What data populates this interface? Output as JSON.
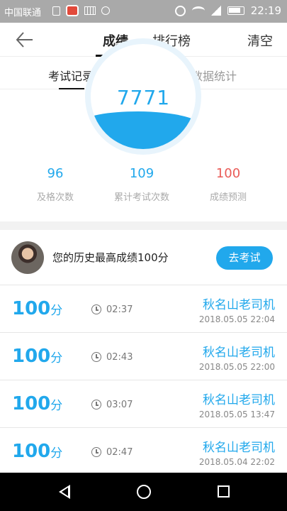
{
  "status_bar": {
    "carrier": "中国联通",
    "time": "22:19"
  },
  "header": {
    "tabs": [
      {
        "label": "成绩",
        "active": true
      },
      {
        "label": "排行榜",
        "active": false
      }
    ],
    "clear_label": "清空"
  },
  "sub_tabs": [
    {
      "label": "考试记录",
      "active": true
    },
    {
      "label": "数据统计",
      "active": false
    }
  ],
  "gauge": {
    "value": "7771"
  },
  "stats": [
    {
      "value": "96",
      "label": "及格次数"
    },
    {
      "value": "109",
      "label": "累计考试次数"
    },
    {
      "value": "100",
      "label": "成绩预测"
    }
  ],
  "best": {
    "text": "您的历史最高成绩100分",
    "button_label": "去考试"
  },
  "records": [
    {
      "score": "100",
      "unit": "分",
      "duration": "02:37",
      "name": "秋名山老司机",
      "datetime": "2018.05.05  22:04"
    },
    {
      "score": "100",
      "unit": "分",
      "duration": "02:43",
      "name": "秋名山老司机",
      "datetime": "2018.05.05  22:00"
    },
    {
      "score": "100",
      "unit": "分",
      "duration": "03:07",
      "name": "秋名山老司机",
      "datetime": "2018.05.05  13:47"
    },
    {
      "score": "100",
      "unit": "分",
      "duration": "02:47",
      "name": "秋名山老司机",
      "datetime": "2018.05.04  22:02"
    }
  ],
  "colors": {
    "accent": "#21a8ec",
    "prediction": "#ea5b57"
  }
}
